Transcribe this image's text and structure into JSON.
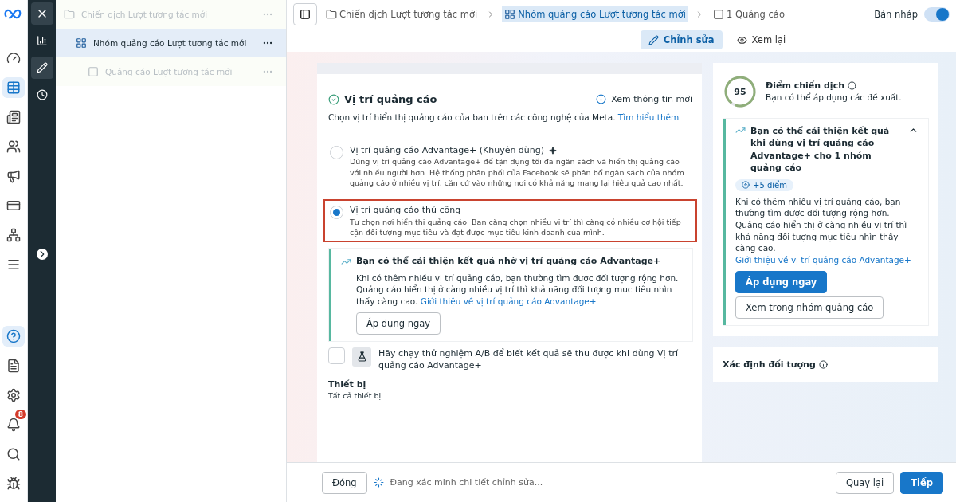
{
  "notifications": {
    "badge": "8"
  },
  "tree": [
    {
      "label": "Chiến dịch Lượt tương tác mới",
      "kind": "campaign",
      "selected": false,
      "children": [
        {
          "label": "Nhóm quảng cáo Lượt tương tác mới",
          "kind": "adset",
          "selected": true,
          "children": [
            {
              "label": "Quảng cáo Lượt tương tác mới",
              "kind": "ad",
              "selected": false
            }
          ]
        }
      ]
    }
  ],
  "breadcrumb": [
    {
      "label": "Chiến dịch Lượt tương tác mới",
      "kind": "campaign",
      "selected": false
    },
    {
      "label": "Nhóm quảng cáo Lượt tương tác mới",
      "kind": "adset",
      "selected": true
    },
    {
      "label": "1 Quảng cáo",
      "kind": "ad",
      "selected": false
    }
  ],
  "status": {
    "label": "Bản nháp",
    "on": true
  },
  "mode_tabs": [
    {
      "label": "Chỉnh sửa",
      "kind": "edit",
      "selected": true
    },
    {
      "label": "Xem lại",
      "kind": "review",
      "selected": false
    }
  ],
  "placement": {
    "title": "Vị trí quảng cáo",
    "info_link": "Xem thông tin mới",
    "description": "Chọn vị trí hiển thị quảng cáo của bạn trên các công nghệ của Meta.",
    "link": "Tìm hiểu thêm",
    "options": [
      {
        "title": "Vị trí quảng cáo Advantage+ (Khuyên dùng)",
        "description": "Dùng vị trí quảng cáo Advantage+ để tận dụng tối đa ngân sách và hiển thị quảng cáo với nhiều người hơn. Hệ thống phân phối của Facebook sẽ phân bổ ngân sách của nhóm quảng cáo ở nhiều vị trí, căn cứ vào những nơi có khả năng mang lại hiệu quả cao nhất.",
        "selected": false,
        "highlighted": false
      },
      {
        "title": "Vị trí quảng cáo thủ công",
        "description": "Tự chọn nơi hiển thị quảng cáo. Bạn càng chọn nhiều vị trí thì càng có nhiều cơ hội tiếp cận đối tượng mục tiêu và đạt được mục tiêu kinh doanh của mình.",
        "selected": true,
        "highlighted": true
      }
    ],
    "tip": {
      "title": "Bạn có thể cải thiện kết quả nhờ vị trí quảng cáo Advantage+",
      "body": "Khi có thêm nhiều vị trí quảng cáo, bạn thường tìm được đối tượng rộng hơn. Quảng cáo hiển thị ở càng nhiều vị trí thì khả năng đối tượng mục tiêu nhìn thấy càng cao.",
      "link": "Giới thiệu về vị trí quảng cáo Advantage+",
      "button": "Áp dụng ngay"
    },
    "ab_test": {
      "label": "Hãy chạy thử nghiệm A/B để biết kết quả sẽ thu được khi dùng Vị trí quảng cáo Advantage+",
      "checked": false
    },
    "devices": {
      "label": "Thiết bị",
      "value": "Tất cả thiết bị"
    }
  },
  "score": {
    "value": "95",
    "level": 0.95,
    "title": "Điểm chiến dịch",
    "subtitle": "Bạn có thể áp dụng các đề xuất.",
    "recommendation": {
      "title": "Bạn có thể cải thiện kết quả khi dùng vị trí quảng cáo Advantage+ cho 1 nhóm quảng cáo",
      "expanded": true,
      "points": "+5 điểm",
      "body": "Khi có thêm nhiều vị trí quảng cáo, bạn thường tìm được đối tượng rộng hơn. Quảng cáo hiển thị ở càng nhiều vị trí thì khả năng đối tượng mục tiêu nhìn thấy càng cao.",
      "link": "Giới thiệu về vị trí quảng cáo Advantage+",
      "primary_button": "Áp dụng ngay",
      "secondary_button": "Xem trong nhóm quảng cáo"
    }
  },
  "audience": {
    "title": "Xác định đối tượng"
  },
  "footer": {
    "close": "Đóng",
    "status": "Đang xác minh chi tiết chỉnh sửa...",
    "back": "Quay lại",
    "next": "Tiếp"
  }
}
